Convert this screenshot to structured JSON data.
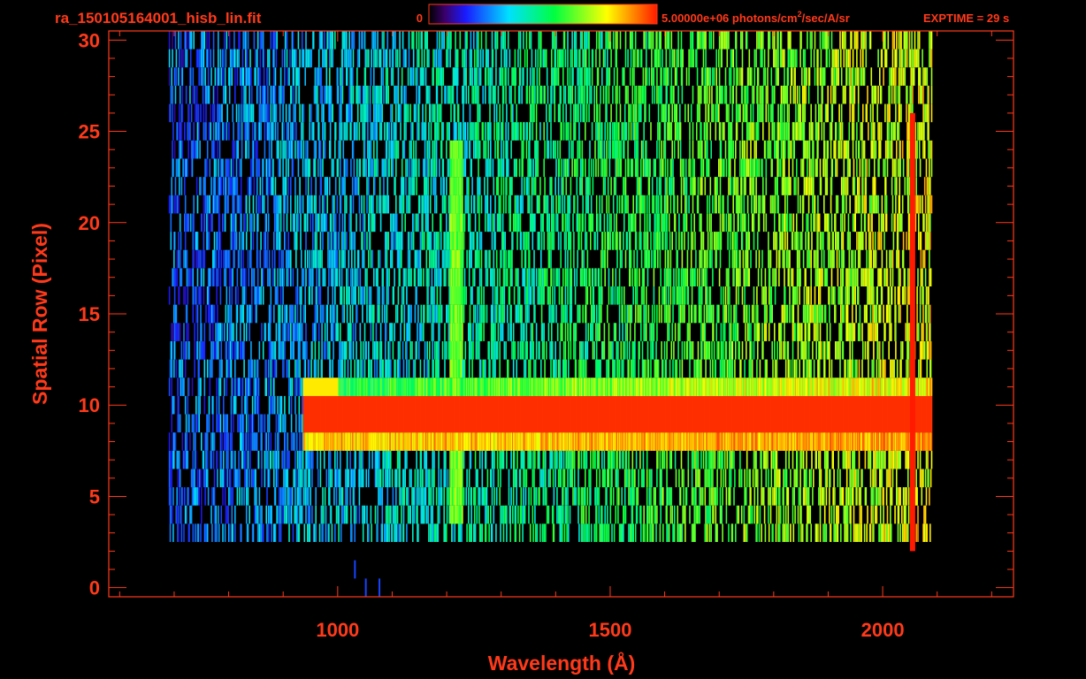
{
  "header": {
    "filename": "ra_150105164001_hisb_lin.fit",
    "colorbar_min": "0",
    "colorbar_max_prefix": "5.00000e+06 photons/cm",
    "colorbar_max_sup": "2",
    "colorbar_max_suffix": "/sec/A/sr",
    "exptime": "EXPTIME = 29 s"
  },
  "colors": {
    "label": "#ff3a1a",
    "background": "#000000"
  },
  "chart_data": {
    "type": "heatmap",
    "title": "ra_150105164001_hisb_lin.fit",
    "xlabel": "Wavelength (Å)",
    "ylabel": "Spatial Row (Pixel)",
    "xlim": [
      580,
      2240
    ],
    "ylim": [
      -0.5,
      30.5
    ],
    "x_ticks": [
      1000,
      1500,
      2000
    ],
    "y_ticks": [
      0,
      5,
      10,
      15,
      20,
      25,
      30
    ],
    "colorbar": {
      "min": 0,
      "max": 5000000,
      "units": "photons/cm^2/sec/A/sr",
      "colormap": "rainbow"
    },
    "exptime_s": 29,
    "grid": false,
    "features": [
      {
        "name": "bright spectral trace",
        "rows": [
          8,
          11
        ],
        "peak_row": 9.5,
        "wavelength_range": [
          935,
          2060
        ]
      },
      {
        "name": "emission line",
        "wavelength": 1216,
        "rows": [
          4,
          24
        ]
      },
      {
        "name": "noise region",
        "rows": [
          3,
          30
        ],
        "wavelength_range": [
          690,
          2090
        ]
      }
    ]
  }
}
